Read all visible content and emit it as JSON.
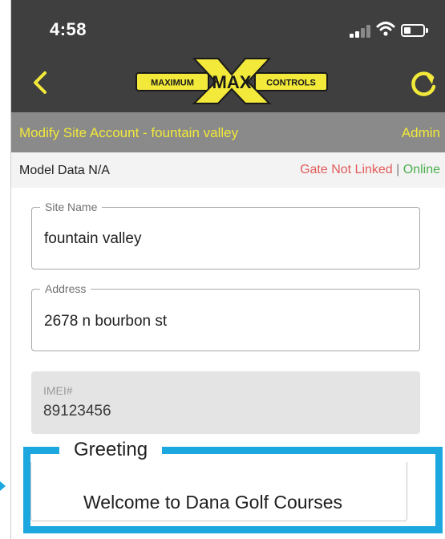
{
  "status_bar": {
    "time": "4:58",
    "icons": [
      "signal-icon",
      "wifi-icon",
      "battery-icon"
    ]
  },
  "header": {
    "back_icon": "chevron-left-icon",
    "refresh_icon": "refresh-icon",
    "logo": {
      "left_word": "MAXIMUM",
      "center_word": "MAX",
      "right_word": "CONTROLS"
    },
    "colors": {
      "accent": "#f2e93a",
      "bar": "#3f3f3f"
    }
  },
  "title_bar": {
    "title": "Modify Site Account - fountain valley",
    "role": "Admin"
  },
  "info_row": {
    "model": "Model Data N/A",
    "gate_status": "Gate Not Linked",
    "separator": "|",
    "connection": "Online"
  },
  "form": {
    "site_name": {
      "label": "Site Name",
      "value": "fountain valley"
    },
    "address": {
      "label": "Address",
      "value": "2678 n bourbon st"
    },
    "imei": {
      "label": "IMEI#",
      "value": "89123456"
    }
  },
  "greeting": {
    "label": "Greeting",
    "value": "Welcome to Dana Golf Courses",
    "highlight_color": "#1da7df"
  }
}
